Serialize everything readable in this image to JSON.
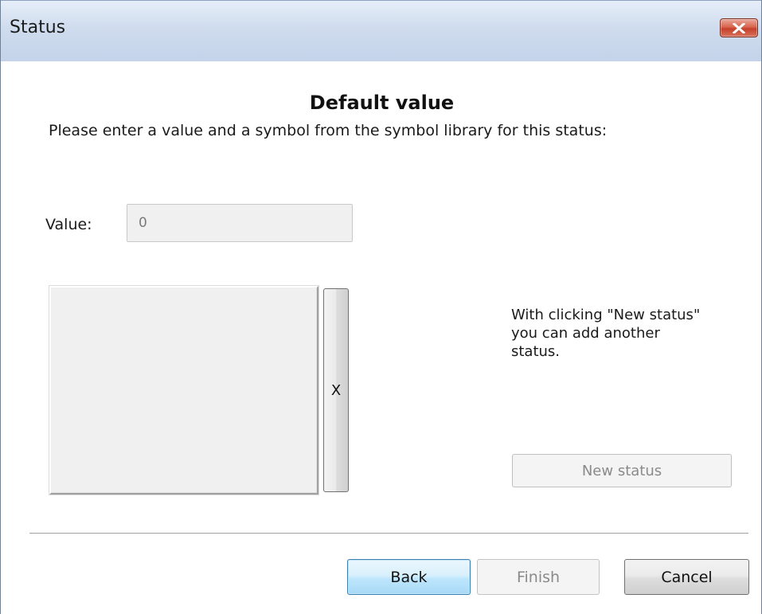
{
  "window": {
    "title": "Status",
    "close_icon": "close-icon"
  },
  "main": {
    "heading": "Default value",
    "instruction": "Please enter a value and a symbol from the symbol library for this status:",
    "value_label": "Value:",
    "value": "0",
    "clear_button_label": "X",
    "hint_lines": [
      "With clicking \"New status\"",
      "you can add another",
      "status."
    ],
    "new_status_label": "New status"
  },
  "footer": {
    "back_label": "Back",
    "finish_label": "Finish",
    "cancel_label": "Cancel"
  },
  "colors": {
    "titlebar": "#c4d3e9",
    "close_button": "#c6402a",
    "default_button_border": "#3c7fb1",
    "disabled_text": "#8a8a8a"
  }
}
